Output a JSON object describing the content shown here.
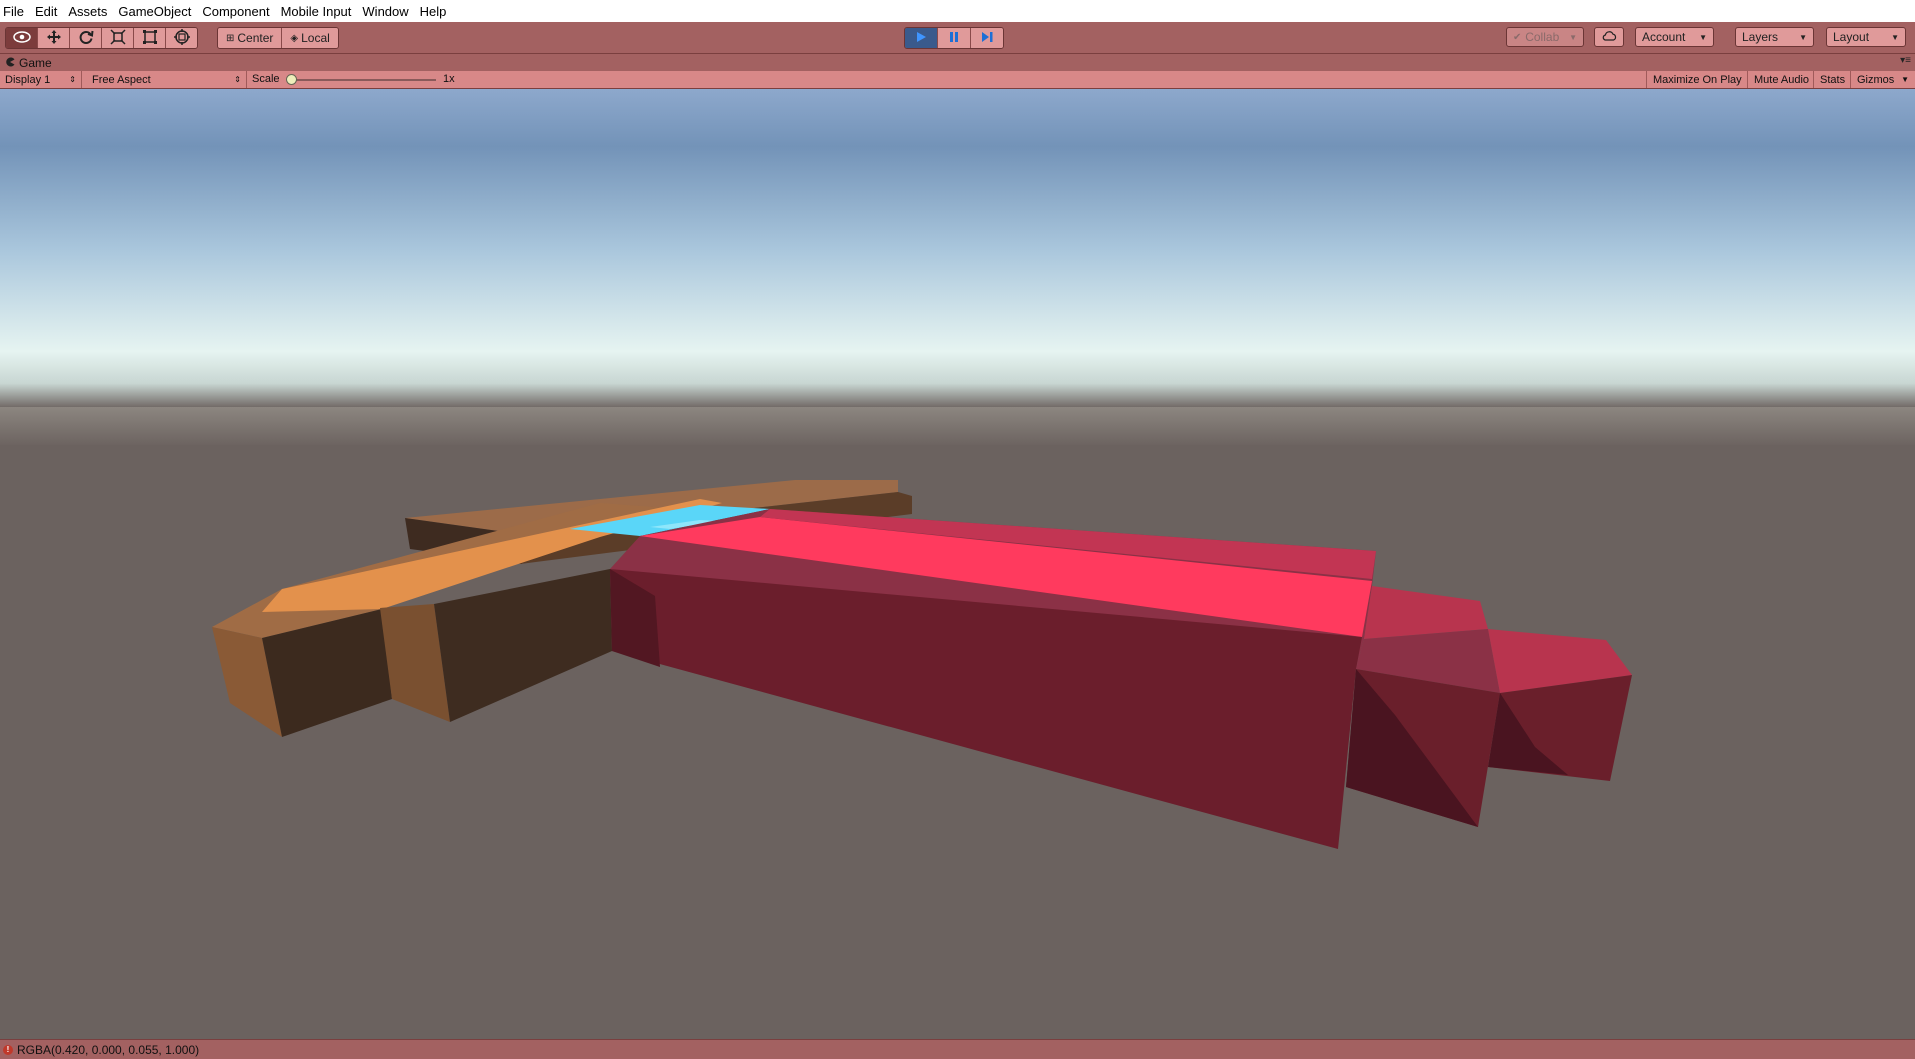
{
  "menu": {
    "items": [
      "File",
      "Edit",
      "Assets",
      "GameObject",
      "Component",
      "Mobile Input",
      "Window",
      "Help"
    ]
  },
  "toolbar": {
    "tools": [
      {
        "name": "view-tool",
        "icon": "eye-icon",
        "glyph": "👁"
      },
      {
        "name": "move-tool",
        "icon": "move-arrows-icon",
        "glyph": "✥"
      },
      {
        "name": "rotate-tool",
        "icon": "rotate-icon",
        "glyph": "⟳"
      },
      {
        "name": "scale-tool",
        "icon": "scale-icon",
        "glyph": "⤧"
      },
      {
        "name": "rect-tool",
        "icon": "rect-icon",
        "glyph": "▣"
      },
      {
        "name": "transform-tool",
        "icon": "transform-icon",
        "glyph": "⊛"
      }
    ],
    "pivot": {
      "center_label": "Center",
      "local_label": "Local"
    },
    "play": {
      "play_icon": "▶",
      "pause_icon": "❚❚",
      "step_icon": "▶❘"
    },
    "collab_label": "Collab",
    "account_label": "Account",
    "layers_label": "Layers",
    "layout_label": "Layout"
  },
  "tab": {
    "title": "Game"
  },
  "game_controls": {
    "display": "Display 1",
    "aspect": "Free Aspect",
    "scale_label": "Scale",
    "scale_value": "1x",
    "maximize_label": "Maximize On Play",
    "mute_label": "Mute Audio",
    "stats_label": "Stats",
    "gizmos_label": "Gizmos"
  },
  "status": {
    "message": "RGBA(0.420, 0.000, 0.055, 1.000)"
  },
  "colors": {
    "toolbar_tint": "#a36161",
    "button_tint": "#e09a9a",
    "sky_top": "#6f8db4",
    "sky_horizon": "#e8f4f0",
    "ground": "#6b625f",
    "wood_light": "#e08a45",
    "wood_dark": "#3d2a1f",
    "blade_top": "#ff3a5e",
    "blade_side": "#6a1f2b",
    "guard_cyan": "#52d4f6"
  }
}
